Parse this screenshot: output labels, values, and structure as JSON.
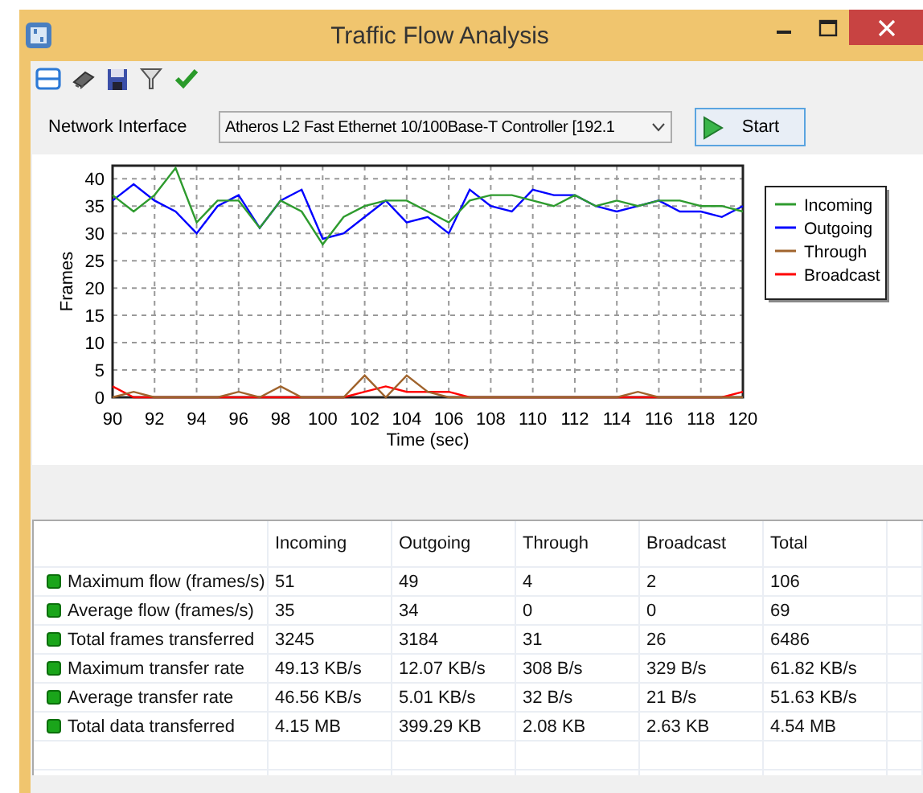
{
  "window": {
    "title": "Traffic Flow Analysis"
  },
  "interface": {
    "label": "Network Interface",
    "value": "Atheros L2 Fast Ethernet 10/100Base-T Controller [192.1"
  },
  "start_button": {
    "label": "Start"
  },
  "chart": {
    "chart_data": {
      "type": "line",
      "xlabel": "Time (sec)",
      "ylabel": "Frames",
      "x": [
        90,
        91,
        92,
        93,
        94,
        95,
        96,
        97,
        98,
        99,
        100,
        101,
        102,
        103,
        104,
        105,
        106,
        107,
        108,
        109,
        110,
        111,
        112,
        113,
        114,
        115,
        116,
        117,
        118,
        119,
        120
      ],
      "grid": true,
      "legend": true,
      "xlim": [
        90,
        120
      ],
      "ylim": [
        0,
        42.4
      ],
      "xticks": [
        90,
        92,
        94,
        96,
        98,
        100,
        102,
        104,
        106,
        108,
        110,
        112,
        114,
        116,
        118,
        120
      ],
      "yticks": [
        0,
        5,
        10,
        15,
        20,
        25,
        30,
        35,
        40
      ],
      "series": [
        {
          "name": "Incoming",
          "color": "#2e9b2e",
          "values": [
            37,
            34,
            37,
            42,
            32,
            36,
            36,
            31,
            36,
            34,
            28,
            33,
            35,
            36,
            36,
            34,
            32,
            36,
            37,
            37,
            36,
            35,
            37,
            35,
            36,
            35,
            36,
            36,
            35,
            35,
            34
          ]
        },
        {
          "name": "Outgoing",
          "color": "#0000ff",
          "values": [
            36,
            39,
            36,
            34,
            30,
            35,
            37,
            31,
            36,
            38,
            29,
            30,
            33,
            36,
            32,
            33,
            30,
            38,
            35,
            34,
            38,
            37,
            37,
            35,
            34,
            35,
            36,
            34,
            34,
            33,
            35
          ]
        },
        {
          "name": "Through",
          "color": "#a0642d",
          "values": [
            0,
            1,
            0,
            0,
            0,
            0,
            1,
            0,
            2,
            0,
            0,
            0,
            4,
            0,
            4,
            1,
            0,
            0,
            0,
            0,
            0,
            0,
            0,
            0,
            0,
            1,
            0,
            0,
            0,
            0,
            0
          ]
        },
        {
          "name": "Broadcast",
          "color": "#ff0000",
          "values": [
            2,
            0,
            0,
            0,
            0,
            0,
            0,
            0,
            0,
            0,
            0,
            0,
            1,
            2,
            1,
            1,
            1,
            0,
            0,
            0,
            0,
            0,
            0,
            0,
            0,
            0,
            0,
            0,
            0,
            0,
            1
          ]
        }
      ]
    }
  },
  "table": {
    "columns": [
      "Incoming",
      "Outgoing",
      "Through",
      "Broadcast",
      "Total"
    ],
    "rows": [
      {
        "label": "Maximum flow (frames/s)",
        "values": [
          "51",
          "49",
          "4",
          "2",
          "106"
        ]
      },
      {
        "label": "Average flow (frames/s)",
        "values": [
          "35",
          "34",
          "0",
          "0",
          "69"
        ]
      },
      {
        "label": "Total frames transferred",
        "values": [
          "3245",
          "3184",
          "31",
          "26",
          "6486"
        ]
      },
      {
        "label": "Maximum transfer rate",
        "values": [
          "49.13 KB/s",
          "12.07 KB/s",
          "308 B/s",
          "329 B/s",
          "61.82 KB/s"
        ]
      },
      {
        "label": "Average transfer rate",
        "values": [
          "46.56 KB/s",
          "5.01 KB/s",
          "32 B/s",
          "21 B/s",
          "51.63 KB/s"
        ]
      },
      {
        "label": "Total data transferred",
        "values": [
          "4.15 MB",
          "399.29 KB",
          "2.08 KB",
          "2.63 KB",
          "4.54 MB"
        ]
      }
    ]
  }
}
